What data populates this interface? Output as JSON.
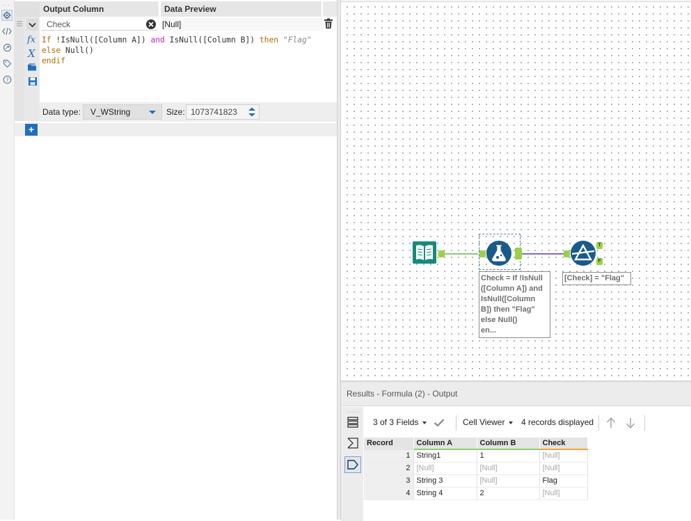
{
  "config": {
    "headers": {
      "output_column": "Output Column",
      "data_preview": "Data Preview"
    },
    "field_name": "Check",
    "preview_value": "[Null]",
    "formula": {
      "line1": {
        "p1": "If ",
        "p2": "!IsNull([Column A]) ",
        "p3": "and",
        "p4": " IsNull([Column B]) ",
        "p5": "then",
        "p6": " ",
        "p7": "\"Flag\""
      },
      "line2": {
        "p1": "else",
        "p2": " Null()"
      },
      "line3": "endif"
    },
    "data_type_label": "Data type:",
    "data_type_value": "V_WString",
    "size_label": "Size:",
    "size_value": "1073741823",
    "add_label": "+"
  },
  "canvas": {
    "formula_annotation": [
      "Check = If !IsNull",
      "([Column A]) and",
      "IsNull([Column",
      "B]) then \"Flag\"",
      "else Null()",
      "en..."
    ],
    "filter_annotation": "[Check] = \"Flag\"",
    "filter_true_label": "T",
    "filter_false_label": "F",
    "colors": {
      "input": "#168a7a",
      "formula": "#1a5a8a",
      "filter": "#1a5a8a",
      "anchor": "#9ad14a",
      "wire_green": "#6ab04c",
      "wire_purple": "#5b3fa8"
    }
  },
  "results": {
    "title": "Results - Formula (2) - Output",
    "fields_label": "3 of 3 Fields",
    "viewer_label": "Cell Viewer",
    "records_label": "4 records displayed",
    "columns": [
      "Record",
      "Column A",
      "Column B",
      "Check"
    ],
    "rows": [
      {
        "record": "1",
        "a": "String1",
        "b": "1",
        "check": "[Null]"
      },
      {
        "record": "2",
        "a": "[Null]",
        "b": "[Null]",
        "check": "[Null]"
      },
      {
        "record": "3",
        "a": "String 3",
        "b": "[Null]",
        "check": "Flag"
      },
      {
        "record": "4",
        "a": "String 4",
        "b": "2",
        "check": "[Null]"
      }
    ]
  }
}
